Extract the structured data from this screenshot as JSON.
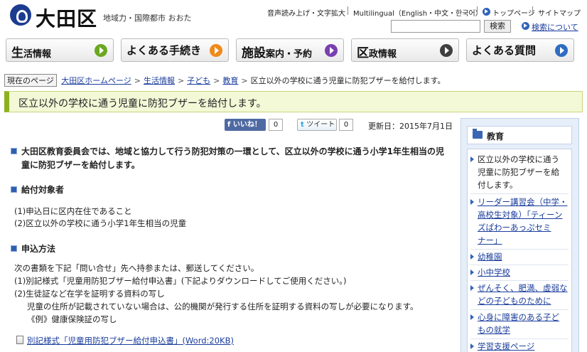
{
  "header": {
    "site_name": "大田区",
    "tagline": "地域力・国際都市 おおた",
    "util_read_aloud": "音声読み上げ・文字拡大",
    "util_multilingual": "Multilingual（English・中文・한국어）",
    "util_top": "トップページ",
    "util_sitemap": "サイトマップ",
    "search_button": "検索",
    "search_help": "検索について"
  },
  "nav": [
    {
      "big": "生",
      "rest": "活情報",
      "color": "#6aa821"
    },
    {
      "big": "",
      "rest": "よくある手続き",
      "color": "#f08a1a"
    },
    {
      "big": "施設",
      "rest": "案内・予約",
      "color": "#7a3fb0"
    },
    {
      "big": "区",
      "rest": "政情報",
      "color": "#3f3f3f"
    },
    {
      "big": "",
      "rest": "よくある質問",
      "color": "#2f6cc2"
    }
  ],
  "breadcrumb": {
    "current_label": "現在のページ",
    "items": [
      "大田区ホームページ",
      "生活情報",
      "子ども",
      "教育"
    ],
    "current": "区立以外の学校に通う児童に防犯ブザーを給付します。"
  },
  "page_title": "区立以外の学校に通う児童に防犯ブザーを給付します。",
  "social": {
    "like_label": "いいね！",
    "like_count": "0",
    "tweet_label": "ツイート",
    "tweet_count": "0"
  },
  "updated": "更新日：2015年7月1日",
  "content": {
    "lead": "大田区教育委員会では、地域と協力して行う防犯対策の一環として、区立以外の学校に通う小学1年生相当の児童に防犯ブザーを給付します。",
    "eligibility_heading": "給付対象者",
    "eligibility": [
      "(1)申込日に区内在住であること",
      "(2)区立以外の学校に通う小学1年生相当の児童"
    ],
    "apply_heading": "申込方法",
    "apply": [
      "次の書類を下記「問い合せ」先へ持参または、郵送してください。",
      "(1)別記様式「児童用防犯ブザー給付申込書」(下記よりダウンロードしてご使用ください。)",
      "(2)生徒証など在学を証明する資料の写し",
      "児童の住所が記載されていない場合は、公的機関が発行する住所を証明する資料の写しが必要になります。",
      "《例》健康保険証の写し"
    ],
    "download_link": "別記様式「児童用防犯ブザー給付申込書」(Word:20KB)"
  },
  "sidebar": {
    "heading": "教育",
    "items": [
      {
        "lines": [
          "区立以外の学校に通う",
          "児童に防犯ブザーを給",
          "付します。"
        ],
        "link": false
      },
      {
        "lines": [
          "リーダー講習会（中学・",
          "高校生対象）「ティーン",
          "ズぱわーあっぷセミ",
          "ナー」"
        ],
        "link": true
      },
      {
        "lines": [
          "幼稚園"
        ],
        "link": true
      },
      {
        "lines": [
          "小中学校"
        ],
        "link": true
      },
      {
        "lines": [
          "ぜんそく、肥満、虚弱な",
          "どの子どものために"
        ],
        "link": true
      },
      {
        "lines": [
          "心身に障害のある子ど",
          "もの就学"
        ],
        "link": true
      },
      {
        "lines": [
          "学習支援ページ"
        ],
        "link": true
      }
    ]
  }
}
